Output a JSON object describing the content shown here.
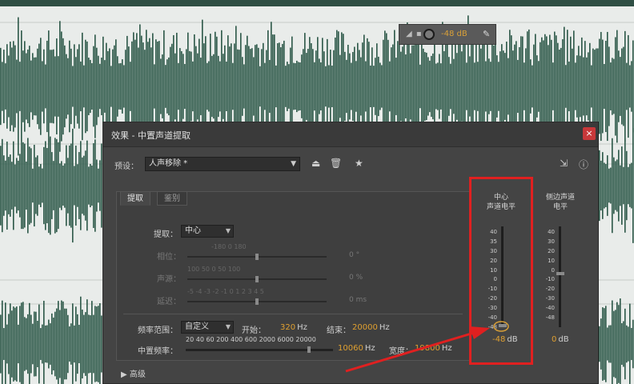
{
  "hud": {
    "value": "-48 dB",
    "dots": "◢ ▪ ▪"
  },
  "dialog": {
    "title": "效果 - 中置声道提取",
    "close_icon": "×",
    "preset_label": "预设：",
    "preset_value": "人声移除 *",
    "tabs": [
      "提取",
      "鉴别"
    ],
    "extract_label": "提取：",
    "extract_value": "中心",
    "pan_label": "相位：",
    "pan_ticks": "-180        0        180",
    "pan_value": "0 °",
    "level_label": "声源：",
    "level_ticks": "100   50    0    50   100",
    "level_value": "0 %",
    "delay_label": "延迟：",
    "delay_ticks": "-5 -4 -3 -2 -1  0  1  2  3  4  5",
    "delay_value": "0 ms",
    "freq_label": "频率范围：",
    "freq_value": "自定义",
    "start_label": "开始：",
    "start_value": "320",
    "start_unit": "Hz",
    "end_label": "结束：",
    "end_value": "20000",
    "end_unit": "Hz",
    "center_freq_label": "中置频率：",
    "center_ticks": "20  40  60   200 400 600 2000  6000  20000",
    "center_value": "10060",
    "center_unit": "Hz",
    "width_label": "宽度：",
    "width_value": "19800",
    "width_unit": "Hz",
    "advanced": "高级",
    "meters": [
      {
        "title_1": "中心",
        "title_2": "声道电平",
        "value": "-48",
        "unit": "dB",
        "fraction": 0.0
      },
      {
        "title_1": "侧边声道",
        "title_2": "电平",
        "value": "0",
        "unit": "dB",
        "fraction": 0.53
      }
    ],
    "scale": [
      "40",
      "35",
      "30",
      "20",
      "10",
      "0",
      "-10",
      "-20",
      "-30",
      "-40",
      "-48"
    ],
    "scale2": [
      "40",
      "30",
      "20",
      "10",
      "0",
      "-10",
      "-20",
      "-30",
      "-40",
      "-48"
    ]
  },
  "colors": {
    "waveform": "#2c5848",
    "accent": "#e0a030",
    "highlight": "#e02020",
    "close": "#c8383a"
  }
}
